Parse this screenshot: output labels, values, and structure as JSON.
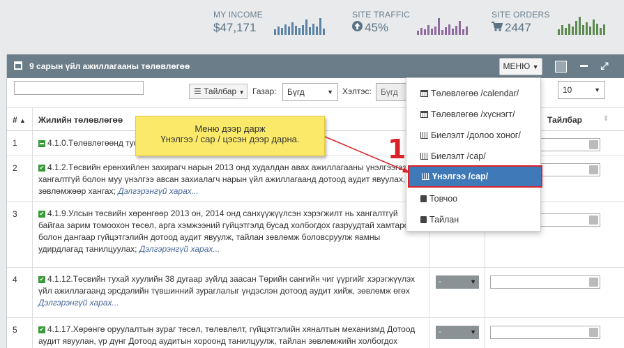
{
  "stats": [
    {
      "label": "MY INCOME",
      "value": "$47,171",
      "icon": "",
      "color": "#5c82a6"
    },
    {
      "label": "SITE TRAFFIC",
      "value": "45%",
      "icon": "arrow-circle-up-icon",
      "color": "#8f6a9f"
    },
    {
      "label": "SITE ORDERS",
      "value": "2447",
      "icon": "cart-icon",
      "color": "#5d8a4f"
    }
  ],
  "panel": {
    "title": "9 сарын үйл ажиллагааны төлөвлөгөө",
    "menu_label": "МЕНЮ"
  },
  "toolbar": {
    "search_value": "",
    "taibar_label": "Тайлбар",
    "gazar_label": "Газар:",
    "gazar_value": "Бүгд",
    "heltes_label": "Хэлтэс:",
    "heltes_value": "Бүгд",
    "page_size": "10"
  },
  "table": {
    "headers": {
      "num": "#",
      "plan": "Жилийн төлөвлөгөө",
      "note": "Тайлбар"
    },
    "rows": [
      {
        "num": "1",
        "text": "4.1.0.Төлөвлөгөөнд тусгаагүй ажил",
        "more": "",
        "status": ""
      },
      {
        "num": "2",
        "text": "4.1.2.Төсвийн ерөнхийлен захирагч нарын 2013 онд худалдан авах ажиллагааны үнэлгээгээр хангалтгүй болон муу үнэлгээ авсан захиалагч нарын үйл ажиллагаанд дотоод аудит явуулах, зөвлөмжөөр хангах;",
        "more": "Дэлгэрэнгүй харах...",
        "status": ""
      },
      {
        "num": "3",
        "text": "4.1.9.Улсын төсвийн хөрөнгөөр 2013 он, 2014 онд санхүүжүүлсэн хэрэгжилт нь хангалтгүй байгаа зарим томоохон төсөл, арга хэмжээний гүйцэтгэлд бусад холбогдох газруудтай хамтарсан болон дангаар гүйцэтгэлийн дотоод аудит явуулж, тайлан зөвлөмж боловсруулж яамны удирдлагад танилцуулах;",
        "more": "Дэлгэрэнгүй харах...",
        "status": ""
      },
      {
        "num": "4",
        "text": "4.1.12.Төсвийн тухай хуулийн 38 дугаар зүйлд заасан Төрийн сангийн чиг үүргийг хэрэгжүүлэх үйл ажиллагаанд эрсдэлийн түвшинний зураглалыг үндэслэн дотоод аудит хийж, зөвлөмж өгөх",
        "more": "Дэлгэрэнгүй харах...",
        "status": "-"
      },
      {
        "num": "5",
        "text": "4.1.17.Хөрөнгө оруулалтын зураг төсөл, төлөвлөлт, гүйцэтгэлийн хяналтын механизмд Дотоод аудит явуулан, үр дүнг Дотоод аудитын хороонд танилцуулж, тайлан зөвлөмжийн холбогдох",
        "more": "",
        "status": "-"
      }
    ]
  },
  "dropdown": {
    "items": [
      {
        "label": "Төлөвлөгөө /calendar/",
        "icon": "calendar-icon"
      },
      {
        "label": "Төлөвлөгөө /хүснэгт/",
        "icon": "calendar-icon"
      },
      {
        "label": "Биелэлт /долоо хоног/",
        "icon": "bar-chart-icon"
      },
      {
        "label": "Биелэлт /сар/",
        "icon": "bar-chart-icon"
      },
      {
        "label": "Үнэлгээ /сар/",
        "icon": "bar-chart-icon"
      },
      {
        "label": "Товчоо",
        "icon": "file-icon"
      },
      {
        "label": "Тайлан",
        "icon": "file-icon"
      }
    ],
    "active_index": 4
  },
  "callout": {
    "line1": "Меню дээр дарж",
    "line2": "Үнэлгээ / сар / цэсэн дээр дарна.",
    "step_number": "1"
  }
}
